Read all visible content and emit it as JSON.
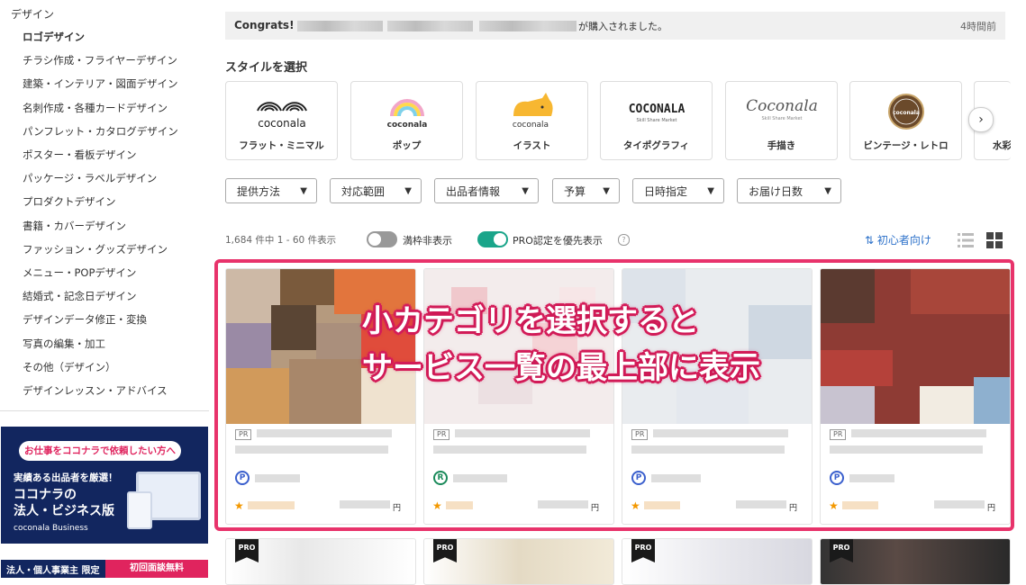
{
  "sidebar": {
    "parent": "デザイン",
    "items": [
      {
        "label": "ロゴデザイン",
        "active": true
      },
      {
        "label": "チラシ作成・フライヤーデザイン"
      },
      {
        "label": "建築・インテリア・図面デザイン"
      },
      {
        "label": "名刺作成・各種カードデザイン"
      },
      {
        "label": "パンフレット・カタログデザイン"
      },
      {
        "label": "ポスター・看板デザイン"
      },
      {
        "label": "パッケージ・ラベルデザイン"
      },
      {
        "label": "プロダクトデザイン"
      },
      {
        "label": "書籍・カバーデザイン"
      },
      {
        "label": "ファッション・グッズデザイン"
      },
      {
        "label": "メニュー・POPデザイン"
      },
      {
        "label": "結婚式・記念日デザイン"
      },
      {
        "label": "デザインデータ修正・変換"
      },
      {
        "label": "写真の編集・加工"
      },
      {
        "label": "その他（デザイン）"
      },
      {
        "label": "デザインレッスン・アドバイス"
      }
    ],
    "banner": {
      "pill": "お仕事をココナラで依頼したい方へ",
      "line1": "実績ある出品者を厳選！",
      "line2": "ココナラの",
      "line3": "法人・ビジネス版",
      "brand": "coconala Business",
      "bottom_left": "法人・個人事業主 限定",
      "bottom_right": "初回面談無料"
    }
  },
  "notice": {
    "congrats": "Congrats!",
    "message": "が購入されました。",
    "time": "4時間前"
  },
  "styles": {
    "heading": "スタイルを選択",
    "cards": [
      {
        "label": "フラット・ミニマル",
        "logo_text": "coconala",
        "icon": "rainbow-arches-icon"
      },
      {
        "label": "ポップ",
        "logo_text": "coconala",
        "icon": "pop-rainbow-icon"
      },
      {
        "label": "イラスト",
        "logo_text": "coconala",
        "icon": "cat-illustration-icon"
      },
      {
        "label": "タイポグラフィ",
        "logo_text": "COCONALA",
        "sub": "Skill Share Market"
      },
      {
        "label": "手描き",
        "logo_text": "Coconala",
        "sub": "Skill Share Market"
      },
      {
        "label": "ビンテージ・レトロ",
        "logo_text": "coconala",
        "icon": "vintage-badge-icon"
      },
      {
        "label": "水彩"
      }
    ]
  },
  "filters": [
    "提供方法",
    "対応範囲",
    "出品者情報",
    "予算",
    "日時指定",
    "お届け日数"
  ],
  "results": {
    "count": "1,684 件中 1 - 60 件表示",
    "toggle_full_hide": "満枠非表示",
    "toggle_pro_first": "PRO認定を優先表示",
    "sort": "初心者向け"
  },
  "cards": {
    "pr_label": "PR",
    "yen": "円",
    "badges": [
      "P",
      "R",
      "P",
      "P"
    ],
    "pro_label": "PRO"
  },
  "overlay": {
    "line1": "小カテゴリを選択すると",
    "line2": "サービス一覧の最上部に表示"
  },
  "colors": {
    "accent_pink": "#e8336b",
    "toggle_on": "#1aa58a",
    "link_blue": "#2b70c9",
    "star": "#f39800",
    "banner_navy": "#12265f"
  }
}
